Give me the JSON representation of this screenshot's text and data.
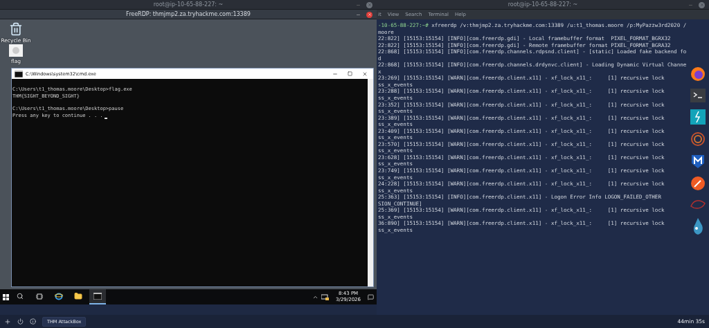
{
  "background_window": {
    "title": "root@ip-10-65-88-227: ~"
  },
  "rdp_window": {
    "title": "FreeRDP: thmjmp2.za.tryhackme.com:13389",
    "desktop_icons": [
      {
        "kind": "recycle",
        "label": "Recycle Bin"
      },
      {
        "kind": "file",
        "label": "flag"
      }
    ],
    "cmd_window": {
      "title": "C:\\Windows\\system32\\cmd.exe",
      "blocks": [
        [
          "C:\\Users\\t1_thomas.moore\\Desktop>flag.exe",
          "THM{SIGHT_BEYOND_SIGHT}"
        ],
        [
          "C:\\Users\\t1_thomas.moore\\Desktop>pause",
          "Press any key to continue . . ."
        ]
      ]
    },
    "taskbar": {
      "apps": [
        {
          "kind": "browser",
          "selected": false
        },
        {
          "kind": "folder",
          "selected": false
        },
        {
          "kind": "console",
          "selected": true
        }
      ],
      "time": "8:43 PM",
      "date": "3/29/2026"
    }
  },
  "terminal": {
    "title": "root@ip-10-65-88-227: ~",
    "menu": [
      "it",
      "View",
      "Search",
      "Terminal",
      "Help"
    ],
    "prompt": "-10-65-88-227:~#",
    "command": "xfreerdp /v:thmjmp2.za.tryhackme.com:13389 /u:t1_thomas.moore /p:MyPazzw3rd2020 /",
    "lines": [
      "moore",
      "22:822] [15153:15154] [INFO][com.freerdp.gdi] - Local framebuffer format  PIXEL_FORMAT_BGRX32",
      "22:822] [15153:15154] [INFO][com.freerdp.gdi] - Remote framebuffer format PIXEL_FORMAT_BGRA32",
      "22:868] [15153:15154] [INFO][com.freerdp.channels.rdpsnd.client] - [static] Loaded fake backend fo",
      "d",
      "22:868] [15153:15154] [INFO][com.freerdp.channels.drdynvc.client] - Loading Dynamic Virtual Channe",
      "x",
      "23:269] [15153:15154] [WARN][com.freerdp.client.x11] - xf_lock_x11_:     [1] recursive lock",
      "ss_x_events",
      "23:288] [15153:15154] [WARN][com.freerdp.client.x11] - xf_lock_x11_:     [1] recursive lock",
      "ss_x_events",
      "23:352] [15153:15154] [WARN][com.freerdp.client.x11] - xf_lock_x11_:     [1] recursive lock",
      "ss_x_events",
      "23:389] [15153:15154] [WARN][com.freerdp.client.x11] - xf_lock_x11_:     [1] recursive lock",
      "ss_x_events",
      "23:409] [15153:15154] [WARN][com.freerdp.client.x11] - xf_lock_x11_:     [1] recursive lock",
      "ss_x_events",
      "23:570] [15153:15154] [WARN][com.freerdp.client.x11] - xf_lock_x11_:     [1] recursive lock",
      "ss_x_events",
      "23:628] [15153:15154] [WARN][com.freerdp.client.x11] - xf_lock_x11_:     [1] recursive lock",
      "ss_x_events",
      "23:749] [15153:15154] [WARN][com.freerdp.client.x11] - xf_lock_x11_:     [1] recursive lock",
      "ss_x_events",
      "24:228] [15153:15154] [WARN][com.freerdp.client.x11] - xf_lock_x11_:     [1] recursive lock",
      "ss_x_events",
      "25:363] [15153:15154] [INFO][com.freerdp.client.x11] - Logon Error Info LOGON_FAILED_OTHER",
      "SION_CONTINUE]",
      "25:369] [15153:15154] [WARN][com.freerdp.client.x11] - xf_lock_x11_:     [1] recursive lock",
      "ss_x_events",
      "36:890] [15153:15154] [WARN][com.freerdp.client.x11] - xf_lock_x11_:     [1] recursive lock",
      "ss_x_events"
    ]
  },
  "bottom_bar": {
    "tab": "THM AttackBox",
    "timer": "44min 35s"
  }
}
